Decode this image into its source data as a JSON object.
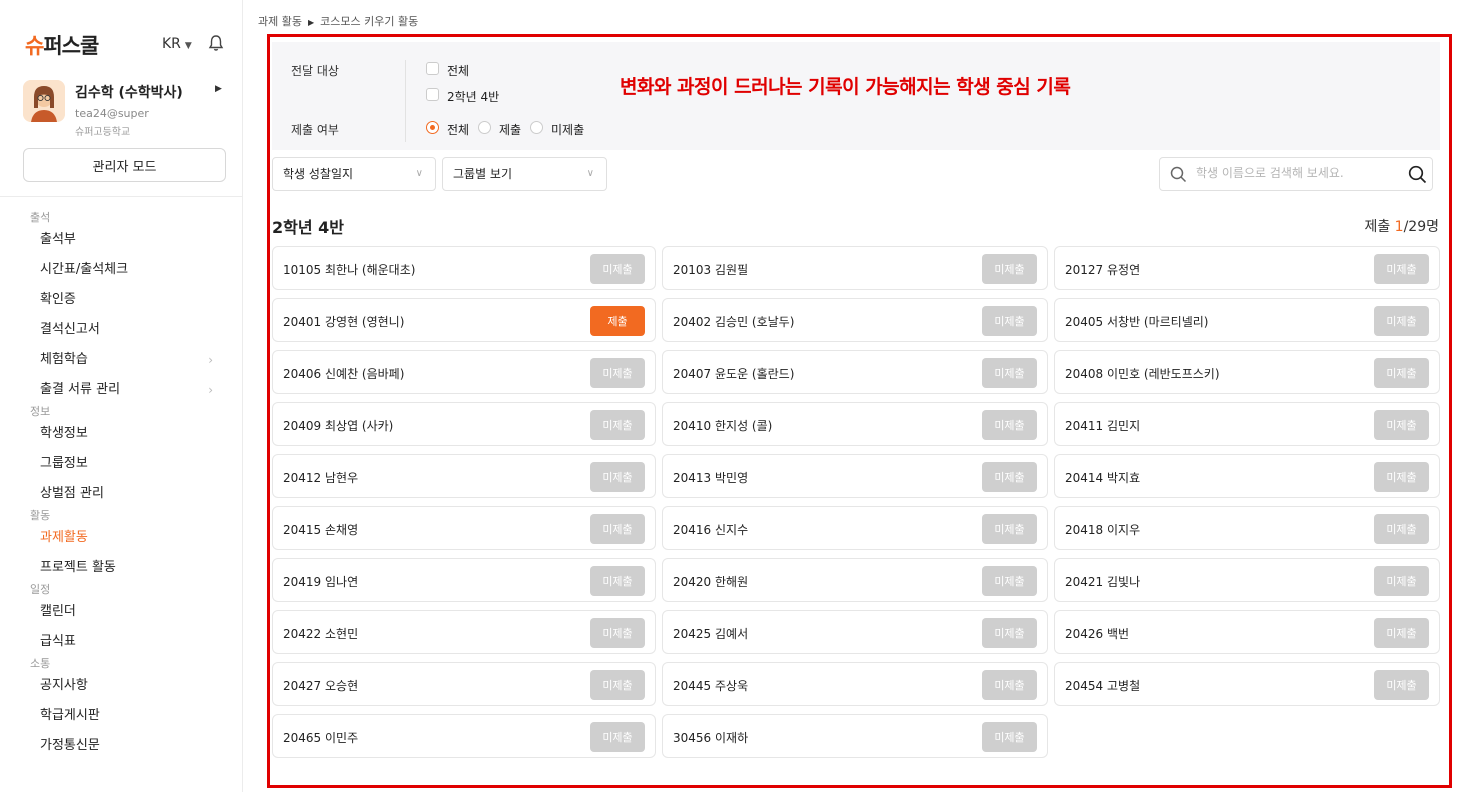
{
  "sidebar": {
    "logo_accent": "슈",
    "logo_rest": "퍼스쿨",
    "lang": "KR",
    "user": {
      "name": "김수학 (수학박사)",
      "id": "tea24@super",
      "school": "슈퍼고등학교"
    },
    "admin_label": "관리자 모드",
    "sections": [
      {
        "title": "출석",
        "items": [
          {
            "label": "출석부"
          },
          {
            "label": "시간표/출석체크"
          },
          {
            "label": "확인증"
          },
          {
            "label": "결석신고서"
          },
          {
            "label": "체험학습",
            "chevron": true
          },
          {
            "label": "출결 서류 관리",
            "chevron": true
          }
        ]
      },
      {
        "title": "정보",
        "items": [
          {
            "label": "학생정보"
          },
          {
            "label": "그룹정보"
          },
          {
            "label": "상벌점 관리"
          }
        ]
      },
      {
        "title": "활동",
        "items": [
          {
            "label": "과제활동",
            "active": true
          },
          {
            "label": "프로젝트 활동"
          }
        ]
      },
      {
        "title": "일정",
        "items": [
          {
            "label": "캘린더"
          },
          {
            "label": "급식표"
          }
        ]
      },
      {
        "title": "소통",
        "items": [
          {
            "label": "공지사항"
          },
          {
            "label": "학급게시판"
          },
          {
            "label": "가정통신문"
          }
        ]
      }
    ]
  },
  "breadcrumb": [
    "과제 활동",
    "코스모스 키우기 활동"
  ],
  "filters": {
    "target_label": "전달 대상",
    "target_options": [
      "전체",
      "2학년 4반"
    ],
    "submit_label": "제출 여부",
    "submit_options": [
      "전체",
      "제출",
      "미제출"
    ],
    "submit_selected": 0
  },
  "headline": "변화와 과정이 드러나는 기록이 가능해지는 학생 중심 기록",
  "toolbar": {
    "select1": "학생 성찰일지",
    "select2": "그룹별 보기",
    "search_placeholder": "학생 이름으로 검색해 보세요."
  },
  "class_title": "2학년 4반",
  "count": {
    "prefix": "제출 ",
    "submitted": "1",
    "suffix": "/29명"
  },
  "status_labels": {
    "done": "제출",
    "pending": "미제출"
  },
  "students": [
    {
      "name": "10105 최한나 (해운대초)",
      "submitted": false
    },
    {
      "name": "20103 김원필",
      "submitted": false
    },
    {
      "name": "20127 유정연",
      "submitted": false
    },
    {
      "name": "20401 강영현 (영현니)",
      "submitted": true
    },
    {
      "name": "20402 김승민 (호날두)",
      "submitted": false
    },
    {
      "name": "20405 서창반 (마르티넬리)",
      "submitted": false
    },
    {
      "name": "20406 신예찬 (음바페)",
      "submitted": false
    },
    {
      "name": "20407 윤도운 (홀란드)",
      "submitted": false
    },
    {
      "name": "20408 이민호 (레반도프스키)",
      "submitted": false
    },
    {
      "name": "20409 최상엽 (사카)",
      "submitted": false
    },
    {
      "name": "20410 한지성 (콜)",
      "submitted": false
    },
    {
      "name": "20411 김민지",
      "submitted": false
    },
    {
      "name": "20412 남현우",
      "submitted": false
    },
    {
      "name": "20413 박민영",
      "submitted": false
    },
    {
      "name": "20414 박지효",
      "submitted": false
    },
    {
      "name": "20415 손채영",
      "submitted": false
    },
    {
      "name": "20416 신지수",
      "submitted": false
    },
    {
      "name": "20418 이지우",
      "submitted": false
    },
    {
      "name": "20419 임나연",
      "submitted": false
    },
    {
      "name": "20420 한해원",
      "submitted": false
    },
    {
      "name": "20421 김빛나",
      "submitted": false
    },
    {
      "name": "20422 소현민",
      "submitted": false
    },
    {
      "name": "20425 김예서",
      "submitted": false
    },
    {
      "name": "20426 백번",
      "submitted": false
    },
    {
      "name": "20427 오승현",
      "submitted": false
    },
    {
      "name": "20445 주상욱",
      "submitted": false
    },
    {
      "name": "20454 고병철",
      "submitted": false
    },
    {
      "name": "20465 이민주",
      "submitted": false
    },
    {
      "name": "30456 이재하",
      "submitted": false
    }
  ]
}
